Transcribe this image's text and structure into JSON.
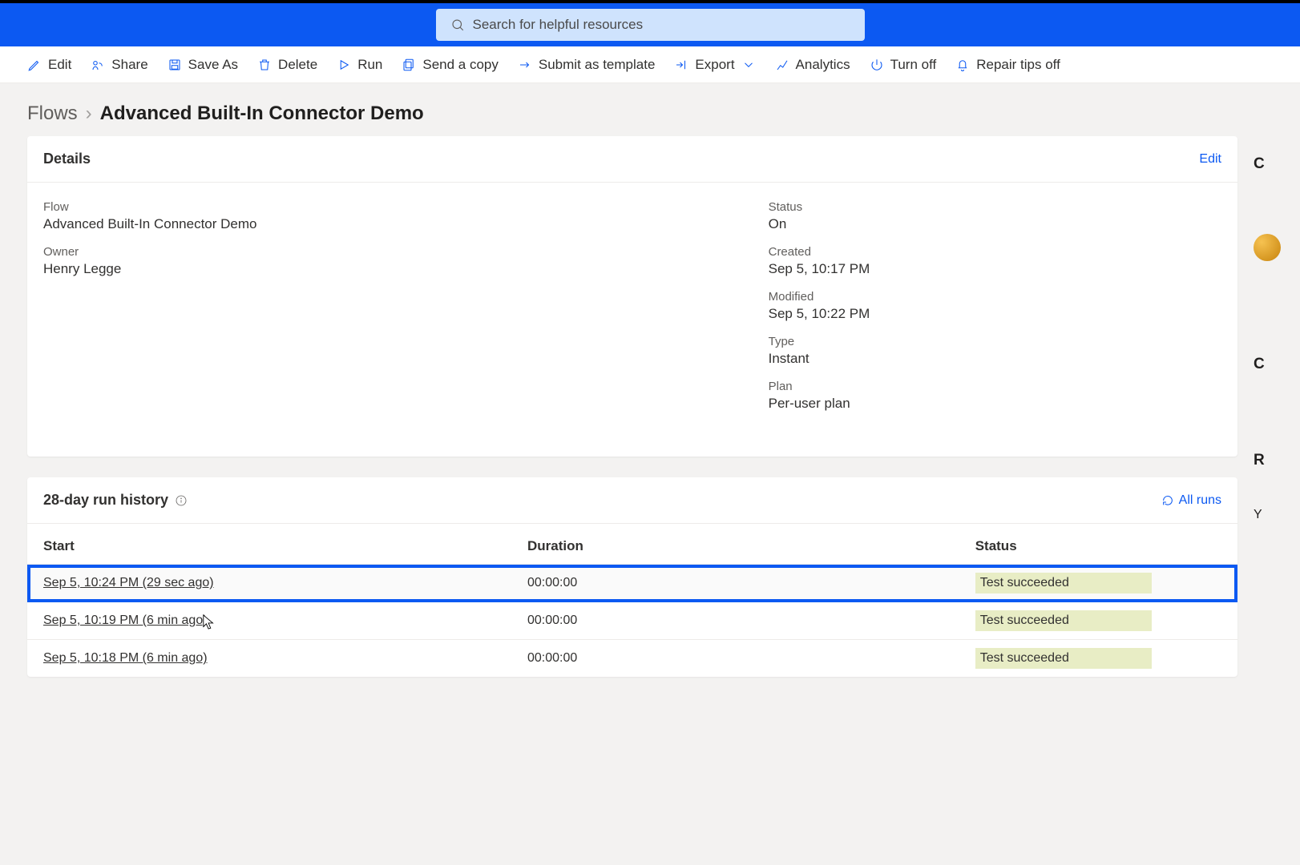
{
  "search": {
    "placeholder": "Search for helpful resources"
  },
  "commands": {
    "edit": "Edit",
    "share": "Share",
    "saveas": "Save As",
    "delete": "Delete",
    "run": "Run",
    "sendcopy": "Send a copy",
    "submit": "Submit as template",
    "export": "Export",
    "analytics": "Analytics",
    "turnoff": "Turn off",
    "repair": "Repair tips off"
  },
  "breadcrumb": {
    "root": "Flows",
    "current": "Advanced Built-In Connector Demo"
  },
  "details": {
    "title": "Details",
    "edit": "Edit",
    "flow_label": "Flow",
    "flow_value": "Advanced Built-In Connector Demo",
    "owner_label": "Owner",
    "owner_value": "Henry Legge",
    "status_label": "Status",
    "status_value": "On",
    "created_label": "Created",
    "created_value": "Sep 5, 10:17 PM",
    "modified_label": "Modified",
    "modified_value": "Sep 5, 10:22 PM",
    "type_label": "Type",
    "type_value": "Instant",
    "plan_label": "Plan",
    "plan_value": "Per-user plan"
  },
  "history": {
    "title": "28-day run history",
    "allruns": "All runs",
    "cols": {
      "start": "Start",
      "duration": "Duration",
      "status": "Status"
    },
    "rows": [
      {
        "start": "Sep 5, 10:24 PM (29 sec ago)",
        "duration": "00:00:00",
        "status": "Test succeeded",
        "highlight": true
      },
      {
        "start": "Sep 5, 10:19 PM (6 min ago)",
        "duration": "00:00:00",
        "status": "Test succeeded",
        "highlight": false
      },
      {
        "start": "Sep 5, 10:18 PM (6 min ago)",
        "duration": "00:00:00",
        "status": "Test succeeded",
        "highlight": false
      }
    ]
  },
  "rightpanel": {
    "c1": "C",
    "c2": "C",
    "r": "R",
    "y": "Y"
  }
}
